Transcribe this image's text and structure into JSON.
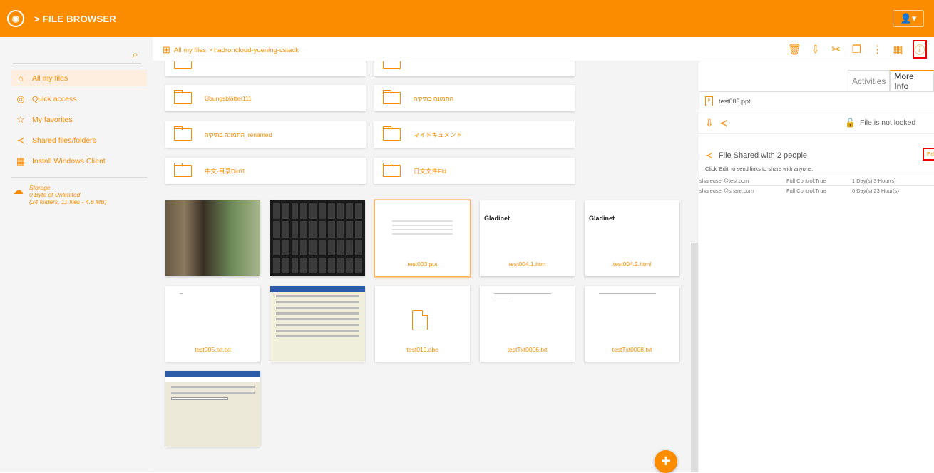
{
  "app": {
    "title": "> FILE BROWSER",
    "logo": "logo-icon",
    "user_icon": "user-icon",
    "caret": "▾"
  },
  "sidebar": {
    "search_placeholder": "",
    "items": [
      {
        "label": "All my files",
        "icon": "home-icon",
        "active": true
      },
      {
        "label": "Quick access",
        "icon": "eye-icon",
        "active": false
      },
      {
        "label": "My favorites",
        "icon": "star-icon",
        "active": false
      },
      {
        "label": "Shared files/folders",
        "icon": "share-icon",
        "active": false
      },
      {
        "label": "Install Windows Client",
        "icon": "windows-icon",
        "active": false
      }
    ],
    "storage": {
      "label": "Storage",
      "used": "0 Byte of Unlimited",
      "summary": "(24 folders, 11 files - 4.8 MB)"
    }
  },
  "toolbar": {
    "breadcrumb": "All my files > hadroncloud-yuening-cstack",
    "tools": [
      "trash-icon",
      "download-icon",
      "cut-icon",
      "copy-icon",
      "more-icon",
      "view-toggle-icon",
      "info-icon"
    ]
  },
  "folders": [
    {
      "name": "Übungsblätter111"
    },
    {
      "name": "התמונה בתיקיה"
    },
    {
      "name": "התמונה בתיקיה_renamed"
    },
    {
      "name": "マイドキュメント"
    },
    {
      "name": "中文-目录Dir01"
    },
    {
      "name": "日文文件Fld"
    }
  ],
  "files": [
    {
      "name": "",
      "kind": "photo-cabinet"
    },
    {
      "name": "",
      "kind": "photo-keyboard"
    },
    {
      "name": "test003.ppt",
      "kind": "slide",
      "selected": true
    },
    {
      "name": "test004.1.htm",
      "kind": "gladinet",
      "preview_text": "Gladinet"
    },
    {
      "name": "test004.2.html",
      "kind": "gladinet",
      "preview_text": "Gladinet"
    },
    {
      "name": "test005.txt.txt",
      "kind": "text"
    },
    {
      "name": "",
      "kind": "dialog"
    },
    {
      "name": "test010.abc",
      "kind": "file-icon"
    },
    {
      "name": "testTxt0006.txt",
      "kind": "text"
    },
    {
      "name": "testTxt0008.txt",
      "kind": "text"
    },
    {
      "name": "",
      "kind": "dialog-wizard"
    }
  ],
  "panel": {
    "tabs": [
      {
        "label": "Activities",
        "active": false
      },
      {
        "label": "More Info",
        "active": true
      }
    ],
    "file_name": "test003.ppt",
    "lock_status": "File is not locked",
    "share_title": "File Shared with 2 people",
    "edit_label": "Edi",
    "share_hint": "Click 'Edit' to send links to share with anyone.",
    "shares": [
      {
        "user": "shareuser@test.com",
        "permission": "Full Control:True",
        "expires": "1 Day(s) 3 Hour(s)"
      },
      {
        "user": "shareuser@share.com",
        "permission": "Full Control:True",
        "expires": "6 Day(s) 23 Hour(s)"
      }
    ]
  },
  "colors": {
    "accent": "#fb8c00",
    "highlight": "#e00000"
  }
}
